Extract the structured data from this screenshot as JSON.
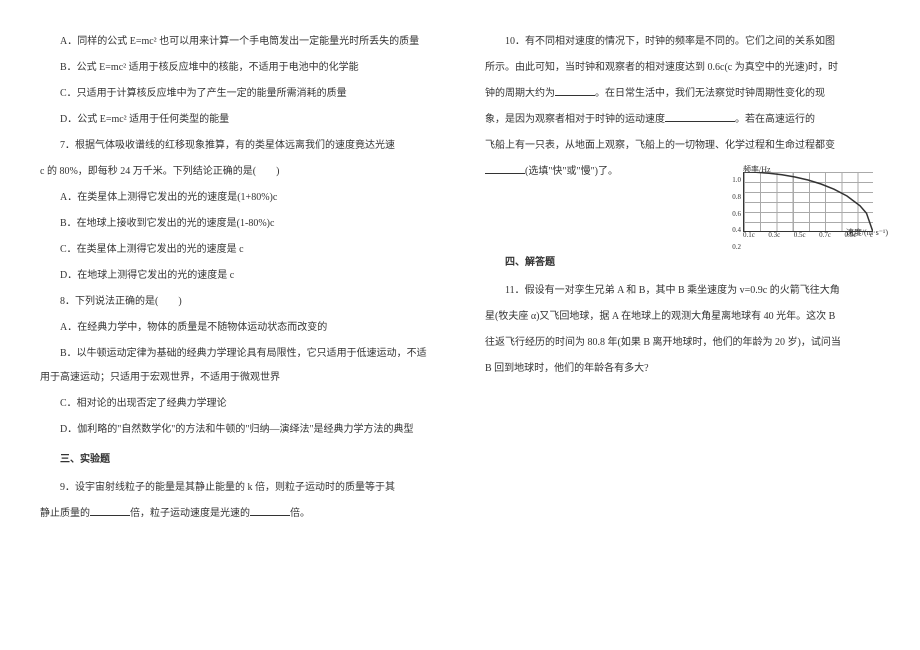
{
  "left": {
    "q6": {
      "A": "A．同样的公式 E=mc² 也可以用来计算一个手电筒发出一定能量光时所丢失的质量",
      "B": "B．公式 E=mc² 适用于核反应堆中的核能，不适用于电池中的化学能",
      "C": "C．只适用于计算核反应堆中为了产生一定的能量所需消耗的质量",
      "D": "D．公式 E=mc² 适用于任何类型的能量"
    },
    "q7": {
      "stem1": "7．根据气体吸收谱线的红移现象推算，有的类星体远离我们的速度竟达光速",
      "stem2": "c 的 80%，即每秒 24 万千米。下列结论正确的是(　　)",
      "A": "A．在类星体上测得它发出的光的速度是(1+80%)c",
      "B": "B．在地球上接收到它发出的光的速度是(1-80%)c",
      "C": "C．在类星体上测得它发出的光的速度是 c",
      "D": "D．在地球上测得它发出的光的速度是 c"
    },
    "q8": {
      "stem": "8．下列说法正确的是(　　)",
      "A": "A．在经典力学中，物体的质量是不随物体运动状态而改变的",
      "B": "B．以牛顿运动定律为基础的经典力学理论具有局限性，它只适用于低速运动，不适用于高速运动；只适用于宏观世界，不适用于微观世界",
      "C": "C．相对论的出现否定了经典力学理论",
      "D": "D．伽利略的\"自然数学化\"的方法和牛顿的\"归纳—演绎法\"是经典力学方法的典型"
    },
    "section3": "三、实验题",
    "q9": {
      "stem1": "9．设宇宙射线粒子的能量是其静止能量的 k 倍，则粒子运动时的质量等于其",
      "stem2_prefix": "静止质量的",
      "stem2_mid": "倍，粒子运动速度是光速的",
      "stem2_suffix": "倍。"
    }
  },
  "right": {
    "q10": {
      "line1": "10．有不同相对速度的情况下，时钟的频率是不同的。它们之间的关系如图",
      "line2_prefix": "所示。由此可知，当时钟和观察者的相对速度达到 0.6c(c 为真空中的光速)时，时",
      "line3_prefix": "钟的周期大约为",
      "line3_suffix": "。在日常生活中，我们无法察觉时钟周期性变化的现",
      "line4_prefix": "象，是因为观察者相对于时钟的运动速度",
      "line4_suffix": "。若在高速运行的",
      "line5": "飞船上有一只表，从地面上观察，飞船上的一切物理、化学过程和生命过程都变",
      "line6_prefix": "",
      "line6_mid": "(选填\"快\"或\"慢\")了。"
    },
    "section4": "四、解答题",
    "q11": {
      "line1": "11．假设有一对孪生兄弟 A 和 B，其中 B 乘坐速度为 v=0.9c 的火箭飞往大角",
      "line2": "星(牧夫座 α)又飞回地球，据 A 在地球上的观测大角星离地球有 40 光年。这次 B",
      "line3": "往返飞行经历的时间为 80.8 年(如果 B 离开地球时，他们的年龄为 20 岁)，试问当",
      "line4": "B 回到地球时，他们的年龄各有多大?"
    }
  },
  "chart_data": {
    "type": "line",
    "title": "",
    "xlabel": "速度/(m·s⁻¹)",
    "ylabel": "频率/Hz",
    "x_ticks": [
      "0.1c",
      "0.3c",
      "0.5c",
      "0.7c",
      "0.9c",
      "c"
    ],
    "y_ticks": [
      "1.0",
      "0.8",
      "0.6",
      "0.4",
      "0.2"
    ],
    "xlim": [
      0,
      1
    ],
    "ylim": [
      0,
      1
    ],
    "x": [
      0.0,
      0.1,
      0.2,
      0.3,
      0.4,
      0.5,
      0.6,
      0.7,
      0.8,
      0.9,
      0.95,
      1.0
    ],
    "y": [
      1.0,
      0.995,
      0.98,
      0.954,
      0.917,
      0.866,
      0.8,
      0.714,
      0.6,
      0.436,
      0.312,
      0.0
    ]
  }
}
